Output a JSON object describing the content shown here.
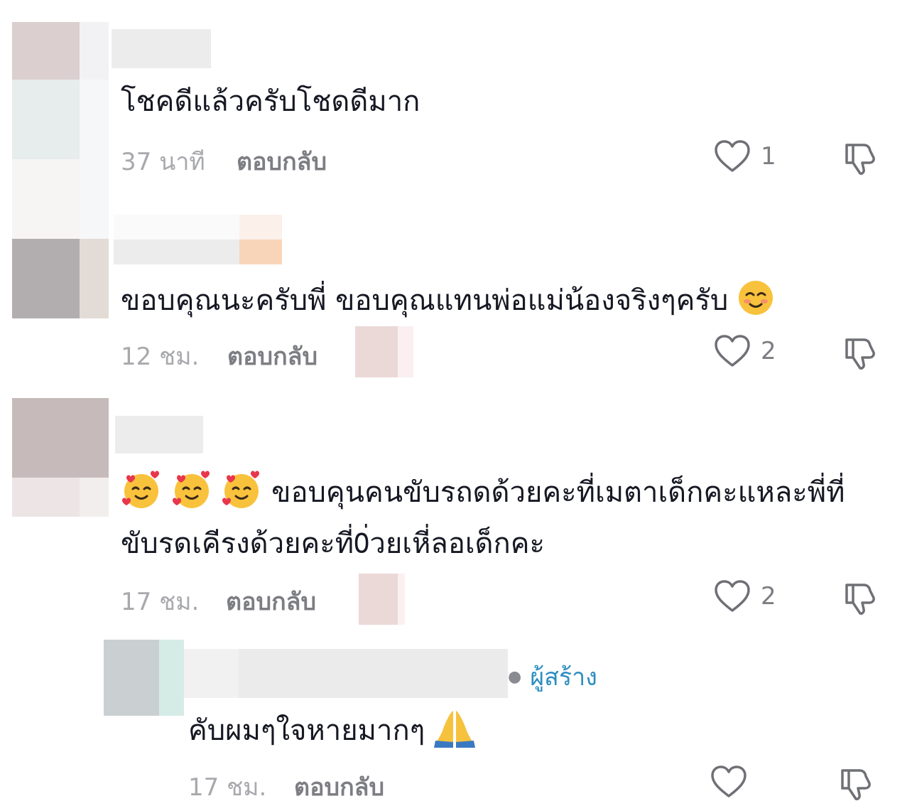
{
  "comments": [
    {
      "text": "โชคดีแล้วครับโชดดีมาก",
      "time": "37 นาที",
      "reply_label": "ตอบกลับ",
      "like_count": "1"
    },
    {
      "text": "ขอบคุณนะครับพี่ ขอบคุณแทนพ่อแม่น้องจริงๆครับ",
      "emoji": "smiling-face-emoji",
      "time": "12 ชม.",
      "reply_label": "ตอบกลับ",
      "like_count": "2"
    },
    {
      "text_line1": "ขอบคุนคนขับรถดด้วยคะที่เมตาเด็กคะแหละพี่ที่",
      "text_line2": "ขับรดเคีรงด้วยคะที่0่วยเหี่ลอเด็กคะ",
      "emoji": "smiling-face-with-hearts-emoji",
      "time": "17 ชม.",
      "reply_label": "ตอบกลับ",
      "like_count": "2"
    }
  ],
  "reply": {
    "creator_label": "ผู้สร้าง",
    "text": "คับผมๆใจหายมากๆ",
    "emoji": "folded-hands-emoji",
    "time": "17 ชม.",
    "reply_label": "ตอบกลับ"
  },
  "colors": {
    "primary_text": "#161823",
    "secondary_text": "#a8a9ad",
    "reply_text": "#7d7e83",
    "creator_accent": "#2c8ec1"
  }
}
